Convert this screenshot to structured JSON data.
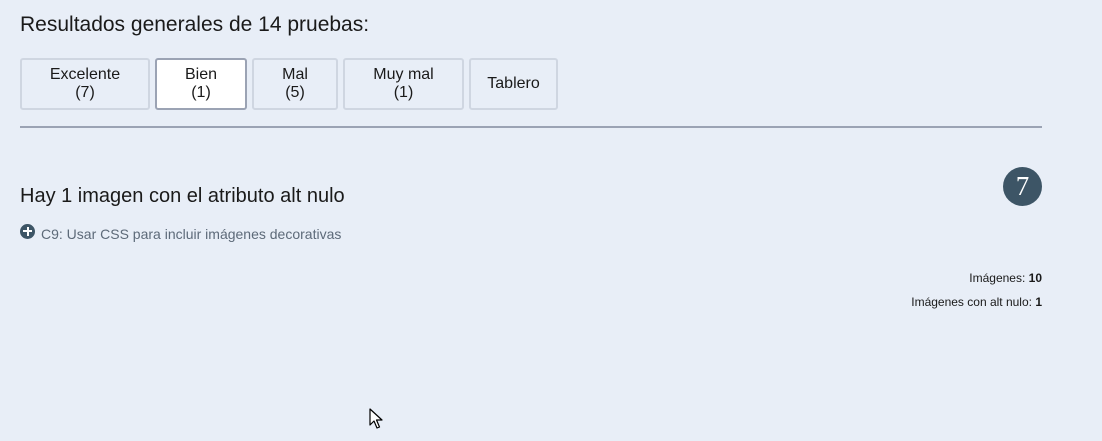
{
  "header": {
    "title": "Resultados generales de 14 pruebas:"
  },
  "tabs": [
    {
      "label": "Excelente (7)",
      "active": false
    },
    {
      "label": "Bien (1)",
      "active": true
    },
    {
      "label": "Mal (5)",
      "active": false
    },
    {
      "label": "Muy mal (1)",
      "active": false
    },
    {
      "label": "Tablero",
      "active": false
    }
  ],
  "result": {
    "title": "Hay 1 imagen con el atributo alt nulo",
    "score": "7",
    "technique": "C9: Usar CSS para incluir imágenes decorativas",
    "stats": [
      {
        "label": "Imágenes: ",
        "value": "10"
      },
      {
        "label": "Imágenes con alt nulo: ",
        "value": "1"
      }
    ]
  },
  "colors": {
    "background": "#e8eef7",
    "badge": "#3d5566",
    "divider": "#9ba3b4"
  }
}
